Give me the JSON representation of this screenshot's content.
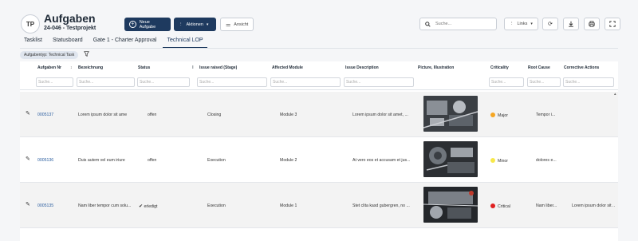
{
  "header": {
    "avatar_initials": "TP",
    "title": "Aufgaben",
    "subtitle": "24-046 - Testprojekt",
    "new_task_label": "Neue Aufgabe",
    "actions_label": "Aktionen",
    "view_label": "Ansicht",
    "search_placeholder": "Suche...",
    "links_label": "Links"
  },
  "tabs": [
    {
      "label": "Tasklist",
      "active": false
    },
    {
      "label": "Statusboard",
      "active": false
    },
    {
      "label": "Gate 1 - Charter Approval",
      "active": false
    },
    {
      "label": "Technical LOP",
      "active": true
    }
  ],
  "filter_chip": "Aufgabentyp: Technical Task",
  "table": {
    "columns": [
      "Aufgaben Nr",
      "Bezeichnung",
      "Status",
      "Issue raised (Stage)",
      "Affected Module",
      "Issue Description",
      "Picture, Illustration",
      "Criticality",
      "Root Cause",
      "Corrective Actions"
    ],
    "filter_placeholder": "Suche...",
    "rows": [
      {
        "nr": "0005137",
        "bezeichnung": "Lorem ipsum dolor sit ame",
        "status": "offen",
        "stage": "Closing",
        "module": "Module 3",
        "description": "Lorem ipsum dolor sit amet, ...",
        "criticality": "Major",
        "root_cause": "Tempor i...",
        "corrective": ""
      },
      {
        "nr": "0005136",
        "bezeichnung": "Duis autem vel eum iriure",
        "status": "offen",
        "stage": "Execution",
        "module": "Module 2",
        "description": "At vero eos et accusam et jus...",
        "criticality": "Minor",
        "root_cause": "dolores e...",
        "corrective": ""
      },
      {
        "nr": "0005135",
        "bezeichnung": "Nam liber tempor cum solu...",
        "status": "erledigt",
        "stage": "Execution",
        "module": "Module 1",
        "description": "Stet clita kasd gubergren, no ...",
        "criticality": "Critical",
        "root_cause": "Nam liber...",
        "corrective": "Lorem ipsum dolor sit ..."
      }
    ]
  },
  "colors": {
    "accent": "#1e3a5f",
    "major": "#f5a623",
    "minor": "#f7e84a",
    "critical": "#e02020"
  }
}
